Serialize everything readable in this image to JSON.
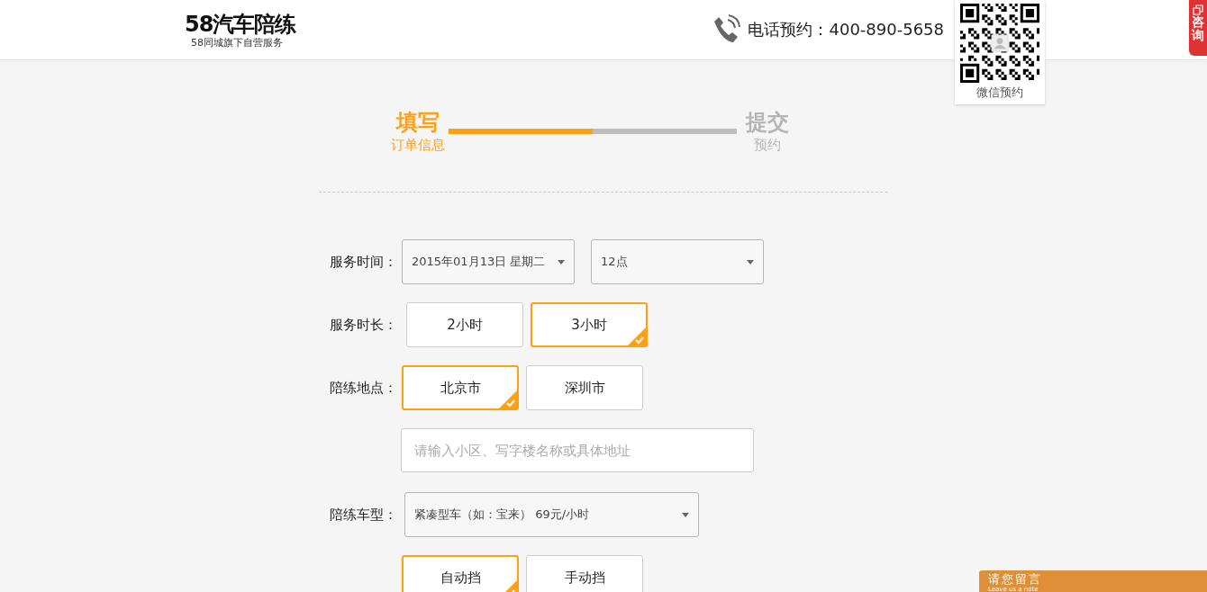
{
  "header": {
    "logo": "58汽车陪练",
    "tagline": "58同城旗下自营服务",
    "phone_label": "电话预约：400-890-5658",
    "qr_caption": "微信预约",
    "consult_tab": "咨询"
  },
  "steps": [
    {
      "title": "填写",
      "subtitle": "订单信息",
      "selected": true
    },
    {
      "title": "提交",
      "subtitle": "预约",
      "selected": false
    }
  ],
  "progress": {
    "level": 0.5
  },
  "form": {
    "rows": [
      {
        "kind": "selects",
        "label": "服务时间：",
        "selects": [
          {
            "value": "2015年01月13日 星期二"
          },
          {
            "value": "12点"
          }
        ]
      },
      {
        "kind": "choices",
        "label": "服务时长：",
        "options": [
          {
            "label": "2小时",
            "selected": false
          },
          {
            "label": "3小时",
            "selected": true
          }
        ]
      },
      {
        "kind": "choices",
        "label": "陪练地点：",
        "options": [
          {
            "label": "北京市",
            "selected": true
          },
          {
            "label": "深圳市",
            "selected": false
          }
        ]
      },
      {
        "kind": "input",
        "placeholder": "请输入小区、写字楼名称或具体地址"
      },
      {
        "kind": "selects",
        "label": "陪练车型：",
        "selects": [
          {
            "value": "紧凑型车（如：宝来） 69元/小时"
          }
        ]
      },
      {
        "kind": "choices",
        "options": [
          {
            "label": "自动挡",
            "selected": true
          },
          {
            "label": "手动挡",
            "selected": false
          }
        ]
      }
    ]
  },
  "message_bar": {
    "title": "请您留言",
    "subtitle": "Leave us a note"
  }
}
